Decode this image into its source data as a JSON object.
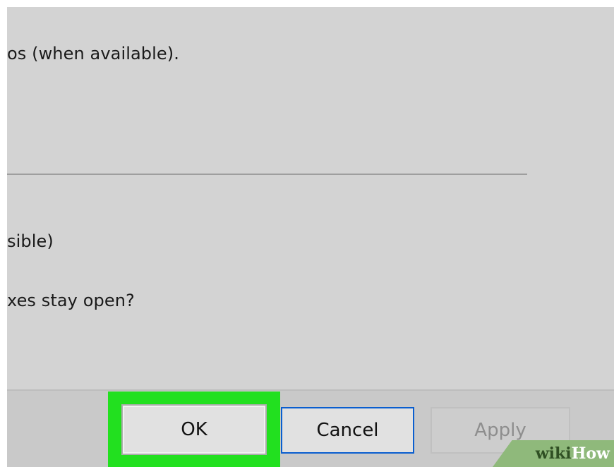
{
  "dialog": {
    "lines": [
      "os (when available).",
      "sible)",
      "xes stay open?"
    ]
  },
  "buttons": {
    "ok": "OK",
    "cancel": "Cancel",
    "apply": "Apply"
  },
  "watermark": {
    "wiki": "wiki",
    "how": "How"
  },
  "colors": {
    "highlight": "#22e01f",
    "dialog_bg": "#d3d3d3",
    "focus_border": "#0a5ecf"
  }
}
